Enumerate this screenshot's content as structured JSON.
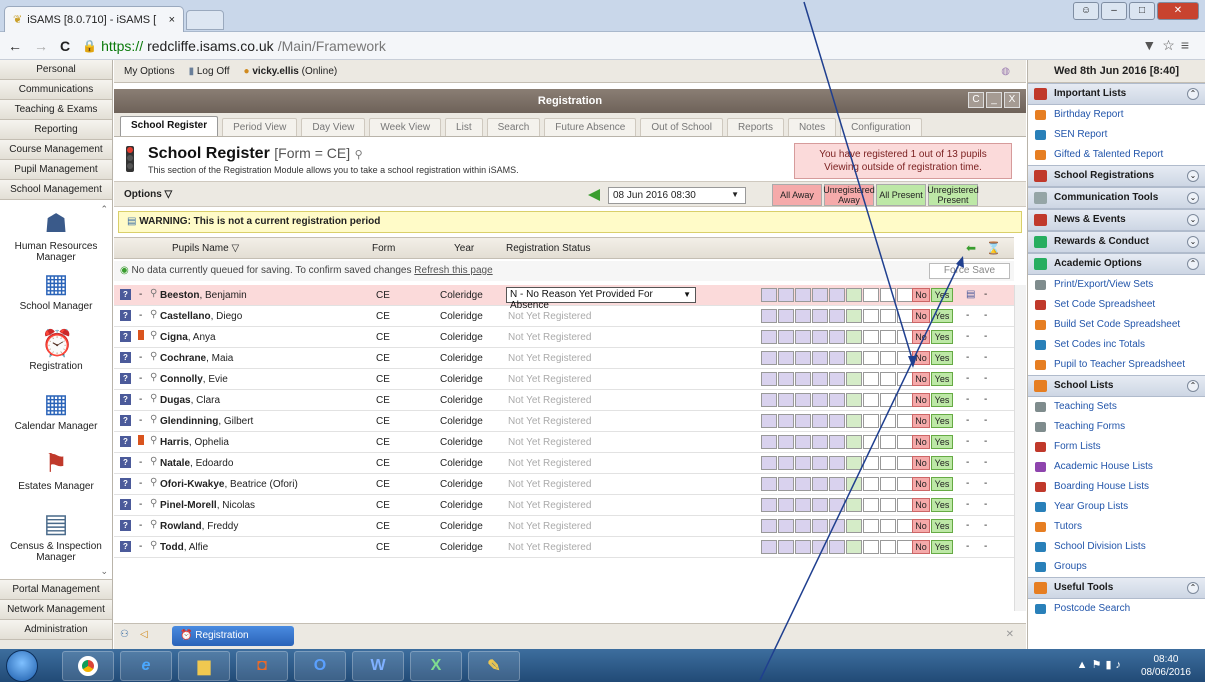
{
  "browser": {
    "tab_title": "iSAMS [8.0.710] - iSAMS [",
    "tab_close": "×",
    "url_scheme": "https://",
    "url_host": "redcliffe.isams.co.uk",
    "url_path": "/Main/Framework",
    "back": "←",
    "forward": "→",
    "reload": "C",
    "menu": "≡",
    "star": "☆",
    "ext": "▼",
    "win_min": "‒",
    "win_max": "□",
    "win_close": "✕"
  },
  "leftnav": {
    "top_items": [
      "Personal",
      "Communications",
      "Teaching & Exams",
      "Reporting",
      "Course Management",
      "Pupil Management",
      "School Management"
    ],
    "launchers": [
      "Human Resources Manager",
      "School Manager",
      "Registration",
      "Calendar Manager",
      "Estates Manager",
      "Census & Inspection Manager"
    ],
    "bottom_items": [
      "Portal Management",
      "Network Management",
      "Administration"
    ]
  },
  "topbar": {
    "my_options": "My Options",
    "log_off": "Log Off",
    "user": "vicky.ellis",
    "status": "(Online)"
  },
  "panel": {
    "title": "Registration",
    "btn_c": "C",
    "btn_min": "_",
    "btn_close": "X",
    "tabs": [
      "School Register",
      "Period View",
      "Day View",
      "Week View",
      "List",
      "Search",
      "Future Absence",
      "Out of School",
      "Reports",
      "Notes",
      "Configuration"
    ],
    "heading": "School Register",
    "heading_form": "[Form = CE]",
    "subtitle": "This section of the Registration Module allows you to take a school registration within iSAMS.",
    "reg_info_line1": "You have registered 1 out of 13 pupils",
    "reg_info_line2": "Viewing outside of registration time.",
    "options_label": "Options ▽",
    "date_value": "08 Jun 2016 08:30",
    "date_caret": "▼",
    "quick_buttons": [
      "All Away",
      "Unregistered Away",
      "All Present",
      "Unregistered Present"
    ],
    "warning": "WARNING: This is not a current registration period",
    "columns": {
      "name": "Pupils Name ▽",
      "form": "Form",
      "year": "Year",
      "status": "Registration Status"
    },
    "queue_text": "No data currently queued for saving.  To confirm saved changes",
    "queue_link": "Refresh this page",
    "force_save": "Force Save",
    "no_label": "No",
    "yes_label": "Yes",
    "dash": "-",
    "not_registered": "Not Yet Registered",
    "selected_status": "N - No Reason Yet Provided For Absence",
    "select_caret": "▼",
    "pupils": [
      {
        "surname": "Beeston",
        "first": ", Benjamin",
        "form": "CE",
        "year": "Coleridge",
        "registered": true,
        "flag": false
      },
      {
        "surname": "Castellano",
        "first": ", Diego",
        "form": "CE",
        "year": "Coleridge",
        "registered": false,
        "flag": false
      },
      {
        "surname": "Cigna",
        "first": ", Anya",
        "form": "CE",
        "year": "Coleridge",
        "registered": false,
        "flag": true
      },
      {
        "surname": "Cochrane",
        "first": ", Maia",
        "form": "CE",
        "year": "Coleridge",
        "registered": false,
        "flag": false
      },
      {
        "surname": "Connolly",
        "first": ", Evie",
        "form": "CE",
        "year": "Coleridge",
        "registered": false,
        "flag": false
      },
      {
        "surname": "Dugas",
        "first": ", Clara",
        "form": "CE",
        "year": "Coleridge",
        "registered": false,
        "flag": false
      },
      {
        "surname": "Glendinning",
        "first": ", Gilbert",
        "form": "CE",
        "year": "Coleridge",
        "registered": false,
        "flag": false
      },
      {
        "surname": "Harris",
        "first": ", Ophelia",
        "form": "CE",
        "year": "Coleridge",
        "registered": false,
        "flag": true
      },
      {
        "surname": "Natale",
        "first": ", Edoardo",
        "form": "CE",
        "year": "Coleridge",
        "registered": false,
        "flag": false
      },
      {
        "surname": "Ofori-Kwakye",
        "first": ", Beatrice (Ofori)",
        "form": "CE",
        "year": "Coleridge",
        "registered": false,
        "flag": false
      },
      {
        "surname": "Pinel-Morell",
        "first": ", Nicolas",
        "form": "CE",
        "year": "Coleridge",
        "registered": false,
        "flag": false
      },
      {
        "surname": "Rowland",
        "first": ", Freddy",
        "form": "CE",
        "year": "Coleridge",
        "registered": false,
        "flag": false
      },
      {
        "surname": "Todd",
        "first": ", Alfie",
        "form": "CE",
        "year": "Coleridge",
        "registered": false,
        "flag": false
      }
    ],
    "task_registration": "Registration"
  },
  "rightside": {
    "date": "Wed 8th Jun 2016 [8:40]",
    "sections": [
      {
        "title": "Important Lists",
        "color": "#c0392b",
        "expanded": true,
        "items": [
          {
            "label": "Birthday Report",
            "color": "#e67e22"
          },
          {
            "label": "SEN Report",
            "color": "#2980b9"
          },
          {
            "label": "Gifted & Talented Report",
            "color": "#e67e22"
          }
        ]
      },
      {
        "title": "School Registrations",
        "color": "#c0392b",
        "expanded": false,
        "items": []
      },
      {
        "title": "Communication Tools",
        "color": "#95a5a6",
        "expanded": false,
        "items": []
      },
      {
        "title": "News & Events",
        "color": "#c0392b",
        "expanded": false,
        "items": []
      },
      {
        "title": "Rewards & Conduct",
        "color": "#27ae60",
        "expanded": false,
        "items": []
      },
      {
        "title": "Academic Options",
        "color": "#27ae60",
        "expanded": true,
        "items": [
          {
            "label": "Print/Export/View Sets",
            "color": "#7f8c8d"
          },
          {
            "label": "Set Code Spreadsheet",
            "color": "#c0392b"
          },
          {
            "label": "Build Set Code Spreadsheet",
            "color": "#e67e22"
          },
          {
            "label": "Set Codes inc Totals",
            "color": "#2980b9"
          },
          {
            "label": "Pupil to Teacher Spreadsheet",
            "color": "#e67e22"
          }
        ]
      },
      {
        "title": "School Lists",
        "color": "#e67e22",
        "expanded": true,
        "items": [
          {
            "label": "Teaching Sets",
            "color": "#7f8c8d"
          },
          {
            "label": "Teaching Forms",
            "color": "#7f8c8d"
          },
          {
            "label": "Form Lists",
            "color": "#c0392b"
          },
          {
            "label": "Academic House Lists",
            "color": "#8e44ad"
          },
          {
            "label": "Boarding House Lists",
            "color": "#c0392b"
          },
          {
            "label": "Year Group Lists",
            "color": "#2980b9"
          },
          {
            "label": "Tutors",
            "color": "#e67e22"
          },
          {
            "label": "School Division Lists",
            "color": "#2980b9"
          },
          {
            "label": "Groups",
            "color": "#2980b9"
          }
        ]
      },
      {
        "title": "Useful Tools",
        "color": "#e67e22",
        "expanded": true,
        "items": [
          {
            "label": "Postcode Search",
            "color": "#2980b9"
          }
        ]
      }
    ]
  },
  "taskbar": {
    "time": "08:40",
    "date": "08/06/2016",
    "apps": [
      "chrome",
      "ie",
      "explorer",
      "outlook",
      "word",
      "excel",
      "isams"
    ]
  }
}
